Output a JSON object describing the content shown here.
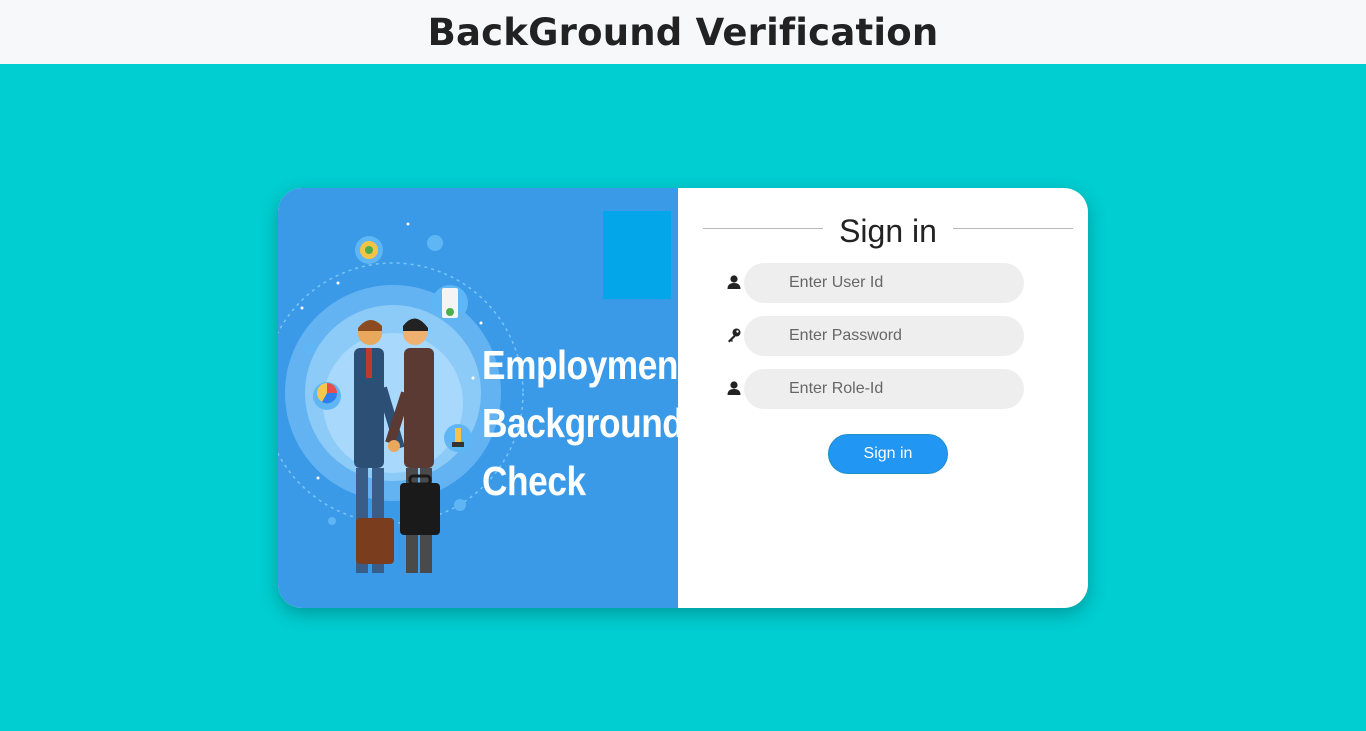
{
  "header": {
    "title": "BackGround Verification"
  },
  "banner": {
    "lines": [
      "Employment",
      "Background",
      "Check"
    ]
  },
  "form": {
    "title": "Sign in",
    "user_id": {
      "placeholder": "Enter User Id",
      "value": "",
      "icon": "user-icon"
    },
    "password": {
      "placeholder": "Enter Password",
      "value": "",
      "icon": "key-icon"
    },
    "role_id": {
      "placeholder": "Enter Role-Id",
      "value": "",
      "icon": "user-icon"
    },
    "submit_label": "Sign in"
  },
  "colors": {
    "page_background": "#00ced1",
    "banner_background": "#3a9ae8",
    "button": "#2196f3",
    "input_background": "#eeeeee"
  }
}
